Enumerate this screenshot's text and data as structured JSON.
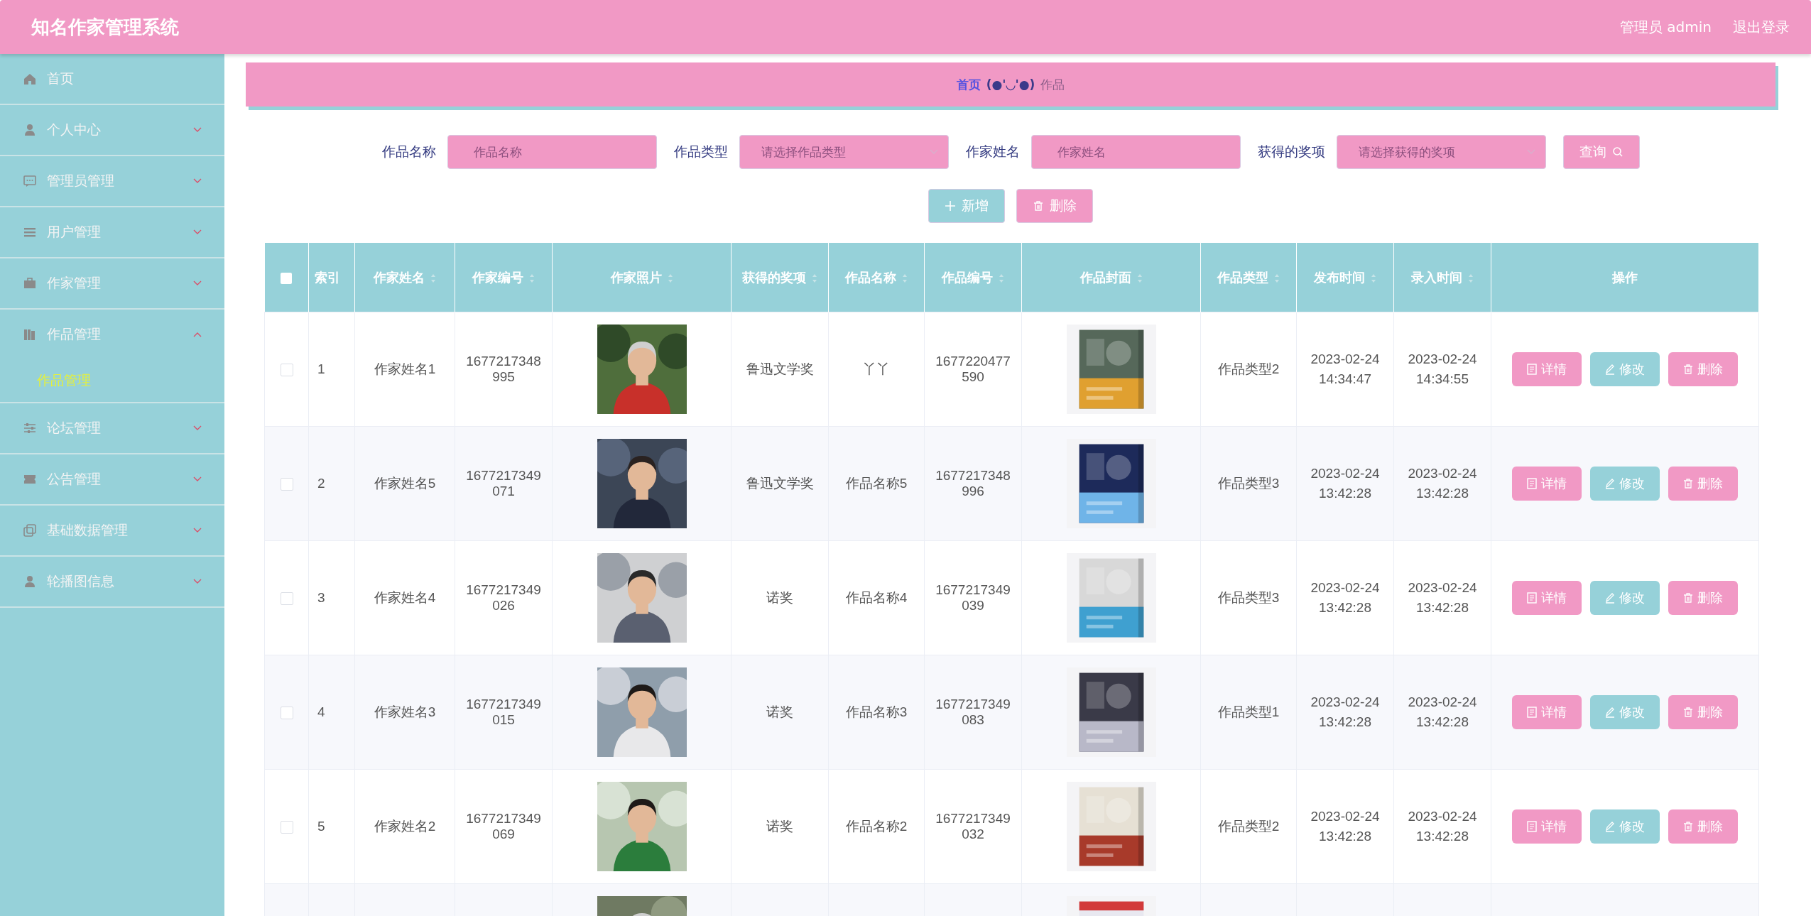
{
  "app": {
    "title": "知名作家管理系统",
    "user": "管理员 admin",
    "logout": "退出登录"
  },
  "sidebar": {
    "items": [
      {
        "label": "首页",
        "kind": "link"
      },
      {
        "label": "个人中心",
        "kind": "menu",
        "expanded": false
      },
      {
        "label": "管理员管理",
        "kind": "menu",
        "expanded": false
      },
      {
        "label": "用户管理",
        "kind": "menu",
        "expanded": false
      },
      {
        "label": "作家管理",
        "kind": "menu",
        "expanded": false
      },
      {
        "label": "作品管理",
        "kind": "menu",
        "expanded": true,
        "children": [
          {
            "label": "作品管理",
            "selected": true
          }
        ]
      },
      {
        "label": "论坛管理",
        "kind": "menu",
        "expanded": false
      },
      {
        "label": "公告管理",
        "kind": "menu",
        "expanded": false
      },
      {
        "label": "基础数据管理",
        "kind": "menu",
        "expanded": false
      },
      {
        "label": "轮播图信息",
        "kind": "menu",
        "expanded": false
      }
    ]
  },
  "breadcrumb": {
    "home": "首页",
    "face": "(●'◡'●)",
    "current": "作品"
  },
  "search": {
    "fields": [
      {
        "label": "作品名称",
        "placeholder": "作品名称",
        "kind": "input"
      },
      {
        "label": "作品类型",
        "placeholder": "请选择作品类型",
        "kind": "select"
      },
      {
        "label": "作家姓名",
        "placeholder": "作家姓名",
        "kind": "input"
      },
      {
        "label": "获得的奖项",
        "placeholder": "请选择获得的奖项",
        "kind": "select"
      }
    ],
    "query": "查询"
  },
  "toolbar": {
    "add": "新增",
    "remove": "删除"
  },
  "table": {
    "select_all": {
      "checked": false
    },
    "columns": [
      {
        "label": "索引",
        "sortable": false
      },
      {
        "label": "作家姓名",
        "sortable": true
      },
      {
        "label": "作家编号",
        "sortable": true
      },
      {
        "label": "作家照片",
        "sortable": true
      },
      {
        "label": "获得的奖项",
        "sortable": true
      },
      {
        "label": "作品名称",
        "sortable": true
      },
      {
        "label": "作品编号",
        "sortable": true
      },
      {
        "label": "作品封面",
        "sortable": true
      },
      {
        "label": "作品类型",
        "sortable": true
      },
      {
        "label": "发布时间",
        "sortable": true
      },
      {
        "label": "录入时间",
        "sortable": true
      },
      {
        "label": "操作",
        "sortable": false
      }
    ],
    "rows": [
      {
        "kind": "full",
        "checked": false,
        "index": "1",
        "writer_name": "作家姓名1",
        "writer_no": "1677217348995",
        "award": "鲁迅文学奖",
        "work_name": "丫丫",
        "work_no": "1677220477590",
        "work_type": "作品类型2",
        "published": "2023-02-24 14:34:47",
        "entered": "2023-02-24 14:34:55",
        "actions": [
          "详情",
          "修改",
          "删除"
        ]
      },
      {
        "kind": "full",
        "checked": false,
        "index": "2",
        "writer_name": "作家姓名5",
        "writer_no": "1677217349071",
        "award": "鲁迅文学奖",
        "work_name": "作品名称5",
        "work_no": "1677217348996",
        "work_type": "作品类型3",
        "published": "2023-02-24 13:42:28",
        "entered": "2023-02-24 13:42:28",
        "actions": [
          "详情",
          "修改",
          "删除"
        ]
      },
      {
        "kind": "full",
        "checked": false,
        "index": "3",
        "writer_name": "作家姓名4",
        "writer_no": "1677217349026",
        "award": "诺奖",
        "work_name": "作品名称4",
        "work_no": "1677217349039",
        "work_type": "作品类型3",
        "published": "2023-02-24 13:42:28",
        "entered": "2023-02-24 13:42:28",
        "actions": [
          "详情",
          "修改",
          "删除"
        ]
      },
      {
        "kind": "full",
        "checked": false,
        "index": "4",
        "writer_name": "作家姓名3",
        "writer_no": "1677217349015",
        "award": "诺奖",
        "work_name": "作品名称3",
        "work_no": "1677217349083",
        "work_type": "作品类型1",
        "published": "2023-02-24 13:42:28",
        "entered": "2023-02-24 13:42:28",
        "actions": [
          "详情",
          "修改",
          "删除"
        ]
      },
      {
        "kind": "full",
        "checked": false,
        "index": "5",
        "writer_name": "作家姓名2",
        "writer_no": "1677217349069",
        "award": "诺奖",
        "work_name": "作品名称2",
        "work_no": "1677217349032",
        "work_type": "作品类型2",
        "published": "2023-02-24 13:42:28",
        "entered": "2023-02-24 13:42:28",
        "actions": [
          "详情",
          "修改",
          "删除"
        ]
      },
      {
        "kind": "partial"
      }
    ]
  }
}
